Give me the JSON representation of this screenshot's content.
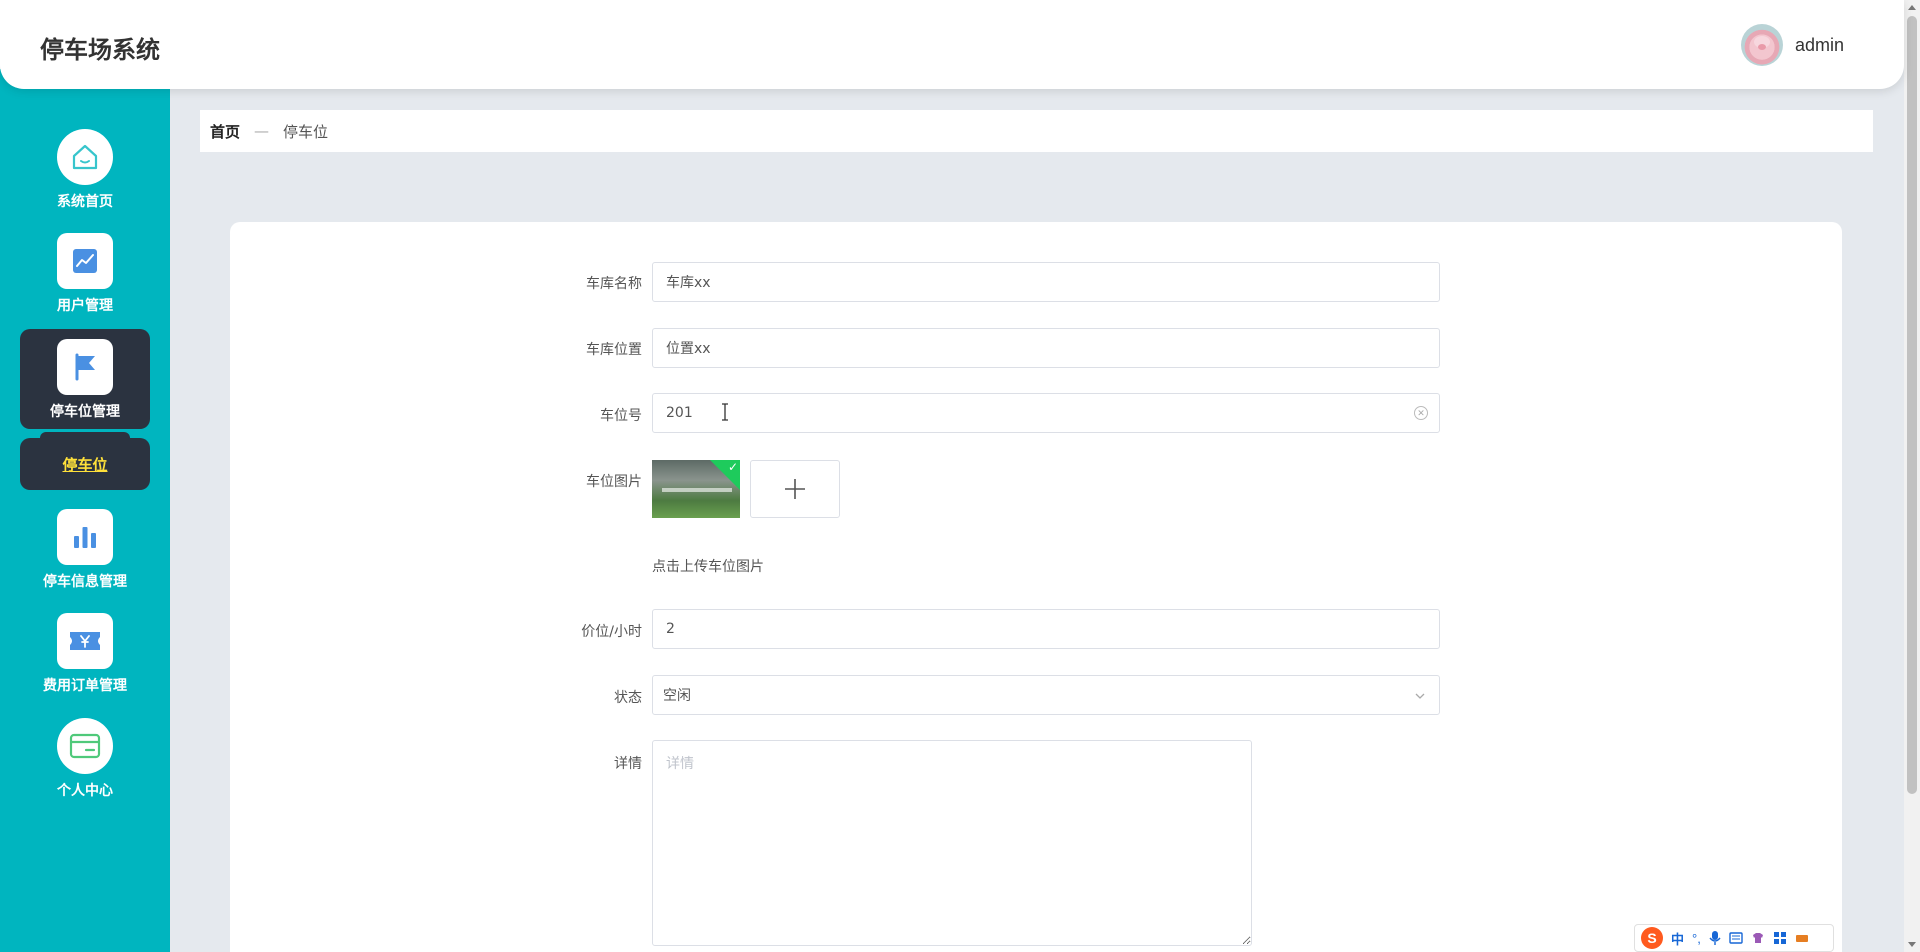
{
  "header": {
    "app_title": "停车场系统",
    "user_name": "admin"
  },
  "sidebar": {
    "items": [
      {
        "label": "系统首页",
        "icon": "home-icon"
      },
      {
        "label": "用户管理",
        "icon": "chart-line-icon"
      },
      {
        "label": "停车位管理",
        "icon": "flag-icon"
      },
      {
        "label": "停车信息管理",
        "icon": "bar-chart-icon"
      },
      {
        "label": "费用订单管理",
        "icon": "ticket-icon"
      },
      {
        "label": "个人中心",
        "icon": "card-icon"
      }
    ],
    "sub_item": {
      "label": "停车位"
    },
    "colors": {
      "background": "#00b5bf",
      "active": "#2b3340",
      "sub_text": "#ffe13a",
      "icon": "#4a90e2"
    }
  },
  "breadcrumb": {
    "home": "首页",
    "separator": "—",
    "current": "停车位"
  },
  "form": {
    "garage_name": {
      "label": "车库名称",
      "value": "车库xx"
    },
    "garage_location": {
      "label": "车库位置",
      "value": "位置xx"
    },
    "spot_number": {
      "label": "车位号",
      "value": "201"
    },
    "spot_image": {
      "label": "车位图片",
      "hint": "点击上传车位图片"
    },
    "price_per_hour": {
      "label": "价位/小时",
      "value": "2"
    },
    "status": {
      "label": "状态",
      "value": "空闲"
    },
    "details": {
      "label": "详情",
      "placeholder": "详情"
    }
  },
  "ime": {
    "logo": "S",
    "mode": "中",
    "punct": "°,"
  }
}
